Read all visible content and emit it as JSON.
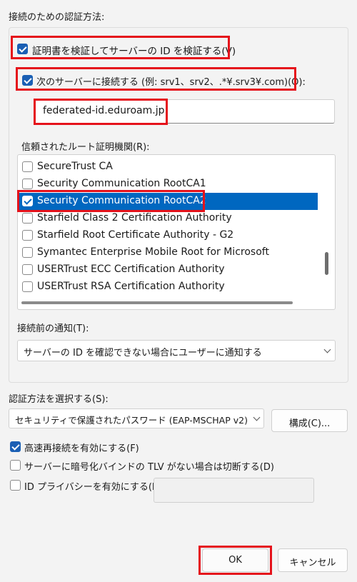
{
  "auth_section": {
    "title": "接続のための認証方法:",
    "verify_cert_label": "証明書を検証してサーバーの ID を検証する(V)",
    "verify_cert_checked": true,
    "connect_servers_label": "次のサーバーに接続する (例: srv1、srv2、.*¥.srv3¥.com)(O):",
    "connect_servers_checked": true,
    "server_value": "federated-id.eduroam.jp",
    "trusted_ca_label": "信頼されたルート証明機関(R):",
    "trusted_ca_items": [
      {
        "label": "SecureTrust CA",
        "checked": false,
        "selected": false
      },
      {
        "label": "Security Communication RootCA1",
        "checked": false,
        "selected": false
      },
      {
        "label": "Security Communication RootCA2",
        "checked": true,
        "selected": true
      },
      {
        "label": "Starfield Class 2 Certification Authority",
        "checked": false,
        "selected": false
      },
      {
        "label": "Starfield Root Certificate Authority - G2",
        "checked": false,
        "selected": false
      },
      {
        "label": "Symantec Enterprise Mobile Root for Microsoft",
        "checked": false,
        "selected": false
      },
      {
        "label": "USERTrust ECC Certification Authority",
        "checked": false,
        "selected": false
      },
      {
        "label": "USERTrust RSA Certification Authority",
        "checked": false,
        "selected": false
      }
    ],
    "notify_label": "接続前の通知(T):",
    "notify_value": "サーバーの ID を確認できない場合にユーザーに通知する"
  },
  "method_section": {
    "label": "認証方法を選択する(S):",
    "method_value": "セキュリティで保護されたパスワード (EAP-MSCHAP v2)",
    "configure_label": "構成(C)...",
    "fast_reconnect_label": "高速再接続を有効にする(F)",
    "fast_reconnect_checked": true,
    "disconnect_tlv_label": "サーバーに暗号化バインドの TLV がない場合は切断する(D)",
    "disconnect_tlv_checked": false,
    "identity_privacy_label": "ID プライバシーを有効にする(I)",
    "identity_privacy_checked": false,
    "identity_privacy_value": ""
  },
  "footer": {
    "ok_label": "OK",
    "cancel_label": "キャンセル"
  },
  "colors": {
    "highlight": "#e5121b",
    "selection": "#0067c0",
    "checkbox": "#1a5fb4"
  }
}
